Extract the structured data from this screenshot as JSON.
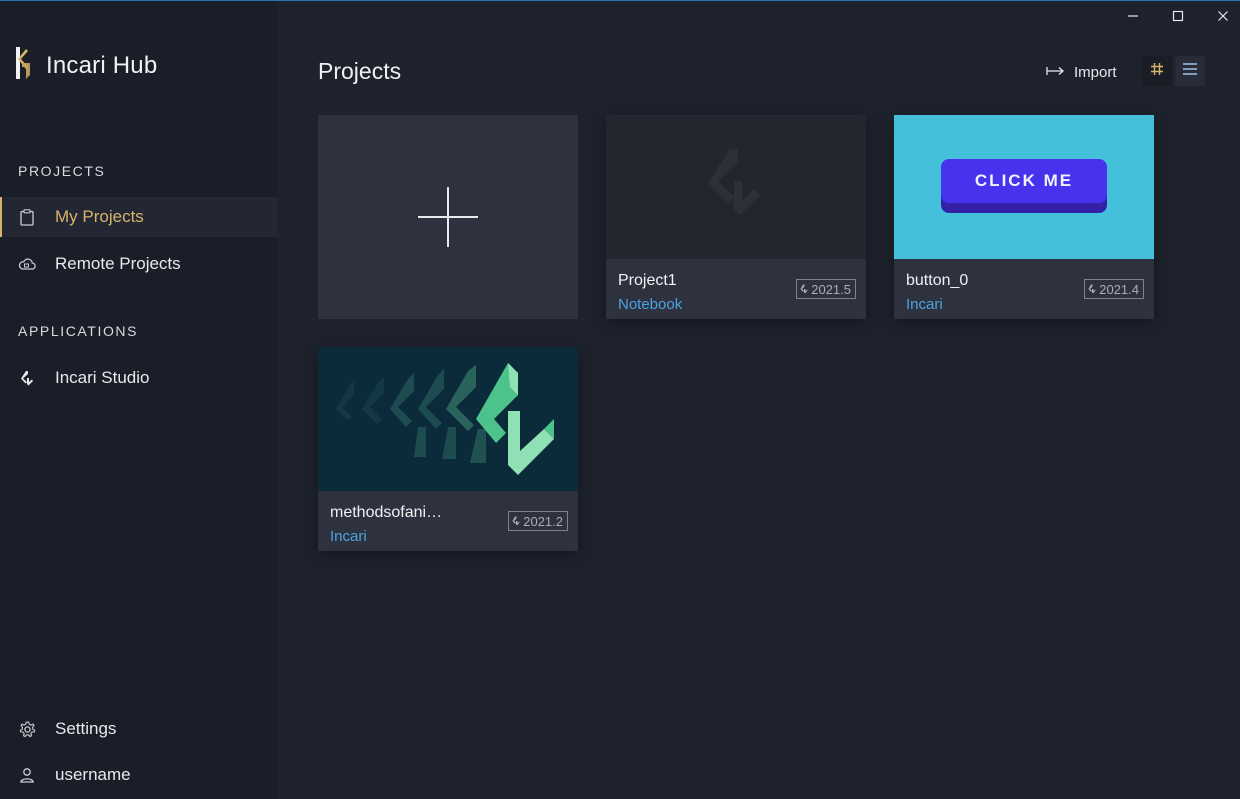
{
  "app": {
    "title": "Incari Hub"
  },
  "sidebar": {
    "sections": {
      "projects": "PROJECTS",
      "applications": "APPLICATIONS"
    },
    "items": [
      {
        "label": "My Projects",
        "icon": "clipboard-icon",
        "active": true
      },
      {
        "label": "Remote Projects",
        "icon": "cloud-icon",
        "active": false
      },
      {
        "label": "Incari Studio",
        "icon": "incari-logo-icon",
        "active": false
      }
    ],
    "footer": [
      {
        "label": "Settings",
        "icon": "gear-icon"
      },
      {
        "label": "username",
        "icon": "user-icon"
      }
    ]
  },
  "header": {
    "title": "Projects",
    "import_label": "Import",
    "view_modes": [
      "grid-view-icon",
      "list-view-icon"
    ]
  },
  "window_controls": [
    "minimize-icon",
    "maximize-icon",
    "close-icon"
  ],
  "projects": [
    {
      "name": "Project1",
      "type": "Notebook",
      "version": "2021.5",
      "thumbnail": "placeholder-logo"
    },
    {
      "name": "button_0",
      "type": "Incari",
      "version": "2021.4",
      "thumbnail": "click-me-button"
    },
    {
      "name": "methodsofani…",
      "type": "Incari",
      "version": "2021.2",
      "thumbnail": "animated-logo"
    }
  ],
  "thumbnails": {
    "button_text": "CLICK ME"
  },
  "colors": {
    "accent_gold": "#d8b46a",
    "link_blue": "#4aa3e0",
    "background": "#1e222d",
    "sidebar": "#1a1e28",
    "card": "#2e323e",
    "thumb_cyan": "#44c0da",
    "thumb_teal": "#0b2a3a",
    "button_purple": "#4733ee"
  }
}
